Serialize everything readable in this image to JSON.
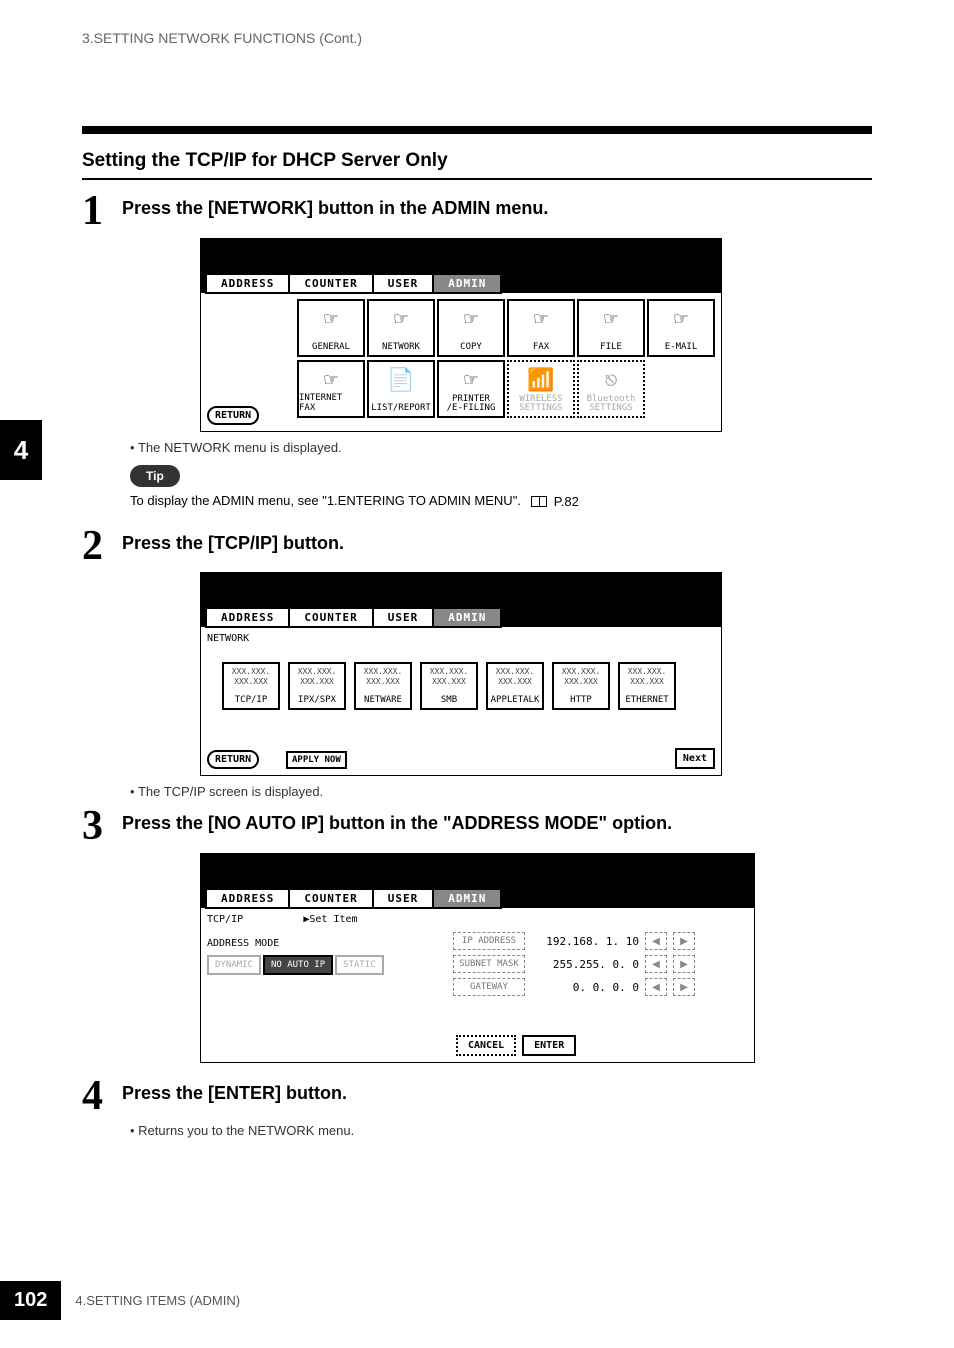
{
  "header": {
    "chapter_running_head": "3.SETTING NETWORK FUNCTIONS (Cont.)"
  },
  "side_tab": {
    "chapter_number": "4"
  },
  "section": {
    "title": "Setting the TCP/IP for DHCP Server Only"
  },
  "steps": {
    "1": {
      "num": "1",
      "text": "Press the [NETWORK] button in the ADMIN menu.",
      "note": "The NETWORK menu is displayed."
    },
    "2": {
      "num": "2",
      "text": "Press the [TCP/IP] button.",
      "note": "The TCP/IP screen is displayed."
    },
    "3": {
      "num": "3",
      "text": "Press the [NO AUTO IP] button in the \"ADDRESS MODE\" option."
    },
    "4": {
      "num": "4",
      "text": "Press the [ENTER] button.",
      "note": "Returns you to the NETWORK menu."
    }
  },
  "tip": {
    "label": "Tip",
    "text": "To display the ADMIN menu, see \"1.ENTERING TO ADMIN MENU\".",
    "page_ref": "P.82"
  },
  "screen_common": {
    "tabs": {
      "address": "ADDRESS",
      "counter": "COUNTER",
      "user": "USER",
      "admin": "ADMIN"
    },
    "return": "RETURN"
  },
  "screen1": {
    "cells_row1": {
      "general": "GENERAL",
      "network": "NETWORK",
      "copy": "COPY",
      "fax": "FAX",
      "file": "FILE",
      "email": "E-MAIL"
    },
    "cells_row2": {
      "internet_fax": "INTERNET FAX",
      "list_report": "LIST/REPORT",
      "printer_efiling": "PRINTER\n/E-FILING",
      "wireless": "WIRELESS\nSETTINGS",
      "bluetooth": "Bluetooth\nSETTINGS"
    }
  },
  "screen2": {
    "crumb": "NETWORK",
    "apply_now": "APPLY NOW",
    "next": "Next",
    "buttons": {
      "tcpip": "TCP/IP",
      "ipxspx": "IPX/SPX",
      "netware": "NETWARE",
      "smb": "SMB",
      "appletalk": "APPLETALK",
      "http": "HTTP",
      "ethernet": "ETHERNET"
    },
    "dummy1": "XXX.XXX.",
    "dummy2": "XXX.XXX"
  },
  "screen3": {
    "crumb": "TCP/IP",
    "set_item": "▶Set Item",
    "address_mode_label": "ADDRESS MODE",
    "modes": {
      "dynamic": "DYNAMIC",
      "no_auto_ip": "NO AUTO IP",
      "static": "STATIC"
    },
    "fields": {
      "ip_address": {
        "label": "IP ADDRESS",
        "value": "192.168.  1. 10"
      },
      "subnet_mask": {
        "label": "SUBNET MASK",
        "value": "255.255.  0.  0"
      },
      "gateway": {
        "label": "GATEWAY",
        "value": "  0.  0.  0.  0"
      }
    },
    "cancel": "CANCEL",
    "enter": "ENTER"
  },
  "footer": {
    "page_number": "102",
    "text": "4.SETTING ITEMS (ADMIN)"
  }
}
